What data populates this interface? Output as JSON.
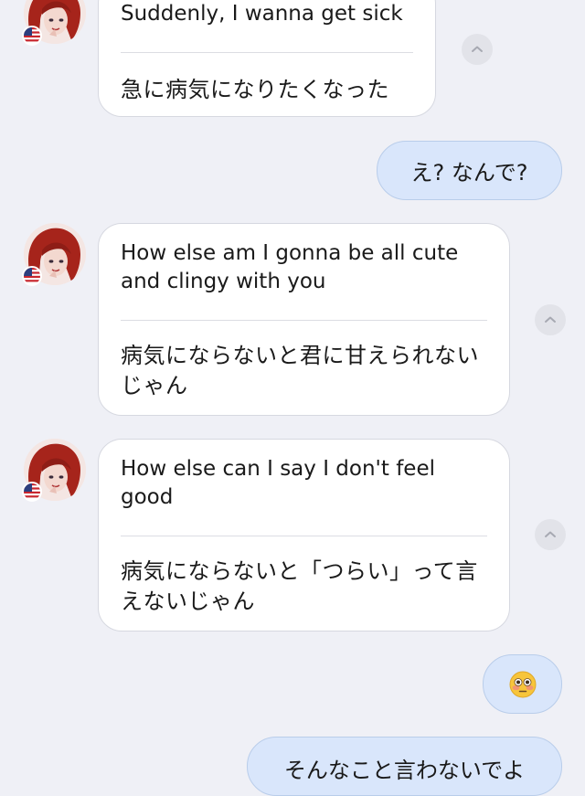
{
  "messages": [
    {
      "sender": "partner",
      "en": "Suddenly, I wanna get sick",
      "ja": "急に病気になりたくなった",
      "flag_icon": "us-flag-icon",
      "collapse_icon": "chevron-up-icon"
    },
    {
      "sender": "me",
      "text": "え? なんで?"
    },
    {
      "sender": "partner",
      "en": "How else am I gonna be all cute and clingy with you",
      "ja": "病気にならないと君に甘えられないじゃん",
      "flag_icon": "us-flag-icon",
      "collapse_icon": "chevron-up-icon"
    },
    {
      "sender": "partner",
      "en": "How else can I say I don't feel good",
      "ja": "病気にならないと「つらい」って言えないじゃん",
      "flag_icon": "us-flag-icon",
      "collapse_icon": "chevron-up-icon"
    },
    {
      "sender": "me",
      "text": "😳"
    },
    {
      "sender": "me",
      "text": "そんなこと言わないでよ"
    }
  ]
}
